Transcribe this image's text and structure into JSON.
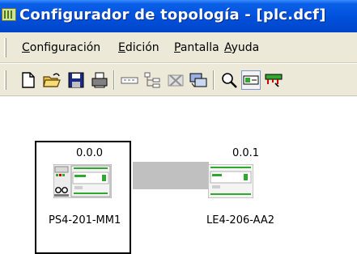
{
  "window": {
    "title": "Configurador de topología - [plc.dcf]",
    "icon": "app-module-icon"
  },
  "menu": {
    "items": [
      {
        "label": "Configuración",
        "accel": "C",
        "rest": "onfiguración"
      },
      {
        "label": "Edición",
        "accel": "E",
        "rest": "dición"
      },
      {
        "label": "Pantalla",
        "accel": "P",
        "rest": "antalla"
      },
      {
        "label": "Ayuda",
        "accel": "A",
        "rest": "yuda"
      }
    ]
  },
  "toolbar": {
    "buttons": [
      "new-file-icon",
      "open-folder-icon",
      "save-disk-icon",
      "print-icon",
      "module-icon",
      "tree-view-icon",
      "delete-module-icon",
      "network-icon",
      "zoom-icon",
      "module-config-icon",
      "bus-config-icon"
    ]
  },
  "topology": {
    "devices": [
      {
        "address": "0.0.0",
        "name": "PS4-201-MM1",
        "selected": true
      },
      {
        "address": "0.0.1",
        "name": "LE4-206-AA2",
        "selected": false
      }
    ],
    "colors": {
      "connection": "#c0c0c0",
      "selection": "#000000",
      "device_green": "#30a830",
      "device_red": "#cc0000"
    }
  }
}
